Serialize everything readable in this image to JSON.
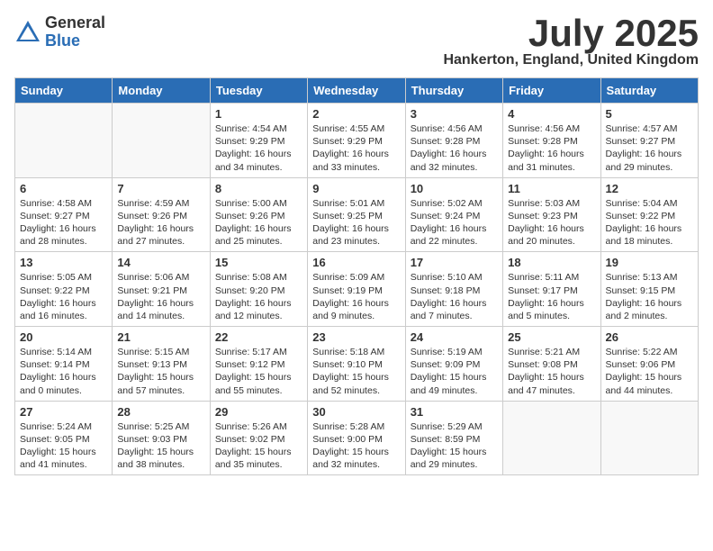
{
  "logo": {
    "general": "General",
    "blue": "Blue"
  },
  "title": "July 2025",
  "location": "Hankerton, England, United Kingdom",
  "days_of_week": [
    "Sunday",
    "Monday",
    "Tuesday",
    "Wednesday",
    "Thursday",
    "Friday",
    "Saturday"
  ],
  "weeks": [
    [
      {
        "day": "",
        "info": ""
      },
      {
        "day": "",
        "info": ""
      },
      {
        "day": "1",
        "info": "Sunrise: 4:54 AM\nSunset: 9:29 PM\nDaylight: 16 hours and 34 minutes."
      },
      {
        "day": "2",
        "info": "Sunrise: 4:55 AM\nSunset: 9:29 PM\nDaylight: 16 hours and 33 minutes."
      },
      {
        "day": "3",
        "info": "Sunrise: 4:56 AM\nSunset: 9:28 PM\nDaylight: 16 hours and 32 minutes."
      },
      {
        "day": "4",
        "info": "Sunrise: 4:56 AM\nSunset: 9:28 PM\nDaylight: 16 hours and 31 minutes."
      },
      {
        "day": "5",
        "info": "Sunrise: 4:57 AM\nSunset: 9:27 PM\nDaylight: 16 hours and 29 minutes."
      }
    ],
    [
      {
        "day": "6",
        "info": "Sunrise: 4:58 AM\nSunset: 9:27 PM\nDaylight: 16 hours and 28 minutes."
      },
      {
        "day": "7",
        "info": "Sunrise: 4:59 AM\nSunset: 9:26 PM\nDaylight: 16 hours and 27 minutes."
      },
      {
        "day": "8",
        "info": "Sunrise: 5:00 AM\nSunset: 9:26 PM\nDaylight: 16 hours and 25 minutes."
      },
      {
        "day": "9",
        "info": "Sunrise: 5:01 AM\nSunset: 9:25 PM\nDaylight: 16 hours and 23 minutes."
      },
      {
        "day": "10",
        "info": "Sunrise: 5:02 AM\nSunset: 9:24 PM\nDaylight: 16 hours and 22 minutes."
      },
      {
        "day": "11",
        "info": "Sunrise: 5:03 AM\nSunset: 9:23 PM\nDaylight: 16 hours and 20 minutes."
      },
      {
        "day": "12",
        "info": "Sunrise: 5:04 AM\nSunset: 9:22 PM\nDaylight: 16 hours and 18 minutes."
      }
    ],
    [
      {
        "day": "13",
        "info": "Sunrise: 5:05 AM\nSunset: 9:22 PM\nDaylight: 16 hours and 16 minutes."
      },
      {
        "day": "14",
        "info": "Sunrise: 5:06 AM\nSunset: 9:21 PM\nDaylight: 16 hours and 14 minutes."
      },
      {
        "day": "15",
        "info": "Sunrise: 5:08 AM\nSunset: 9:20 PM\nDaylight: 16 hours and 12 minutes."
      },
      {
        "day": "16",
        "info": "Sunrise: 5:09 AM\nSunset: 9:19 PM\nDaylight: 16 hours and 9 minutes."
      },
      {
        "day": "17",
        "info": "Sunrise: 5:10 AM\nSunset: 9:18 PM\nDaylight: 16 hours and 7 minutes."
      },
      {
        "day": "18",
        "info": "Sunrise: 5:11 AM\nSunset: 9:17 PM\nDaylight: 16 hours and 5 minutes."
      },
      {
        "day": "19",
        "info": "Sunrise: 5:13 AM\nSunset: 9:15 PM\nDaylight: 16 hours and 2 minutes."
      }
    ],
    [
      {
        "day": "20",
        "info": "Sunrise: 5:14 AM\nSunset: 9:14 PM\nDaylight: 16 hours and 0 minutes."
      },
      {
        "day": "21",
        "info": "Sunrise: 5:15 AM\nSunset: 9:13 PM\nDaylight: 15 hours and 57 minutes."
      },
      {
        "day": "22",
        "info": "Sunrise: 5:17 AM\nSunset: 9:12 PM\nDaylight: 15 hours and 55 minutes."
      },
      {
        "day": "23",
        "info": "Sunrise: 5:18 AM\nSunset: 9:10 PM\nDaylight: 15 hours and 52 minutes."
      },
      {
        "day": "24",
        "info": "Sunrise: 5:19 AM\nSunset: 9:09 PM\nDaylight: 15 hours and 49 minutes."
      },
      {
        "day": "25",
        "info": "Sunrise: 5:21 AM\nSunset: 9:08 PM\nDaylight: 15 hours and 47 minutes."
      },
      {
        "day": "26",
        "info": "Sunrise: 5:22 AM\nSunset: 9:06 PM\nDaylight: 15 hours and 44 minutes."
      }
    ],
    [
      {
        "day": "27",
        "info": "Sunrise: 5:24 AM\nSunset: 9:05 PM\nDaylight: 15 hours and 41 minutes."
      },
      {
        "day": "28",
        "info": "Sunrise: 5:25 AM\nSunset: 9:03 PM\nDaylight: 15 hours and 38 minutes."
      },
      {
        "day": "29",
        "info": "Sunrise: 5:26 AM\nSunset: 9:02 PM\nDaylight: 15 hours and 35 minutes."
      },
      {
        "day": "30",
        "info": "Sunrise: 5:28 AM\nSunset: 9:00 PM\nDaylight: 15 hours and 32 minutes."
      },
      {
        "day": "31",
        "info": "Sunrise: 5:29 AM\nSunset: 8:59 PM\nDaylight: 15 hours and 29 minutes."
      },
      {
        "day": "",
        "info": ""
      },
      {
        "day": "",
        "info": ""
      }
    ]
  ]
}
